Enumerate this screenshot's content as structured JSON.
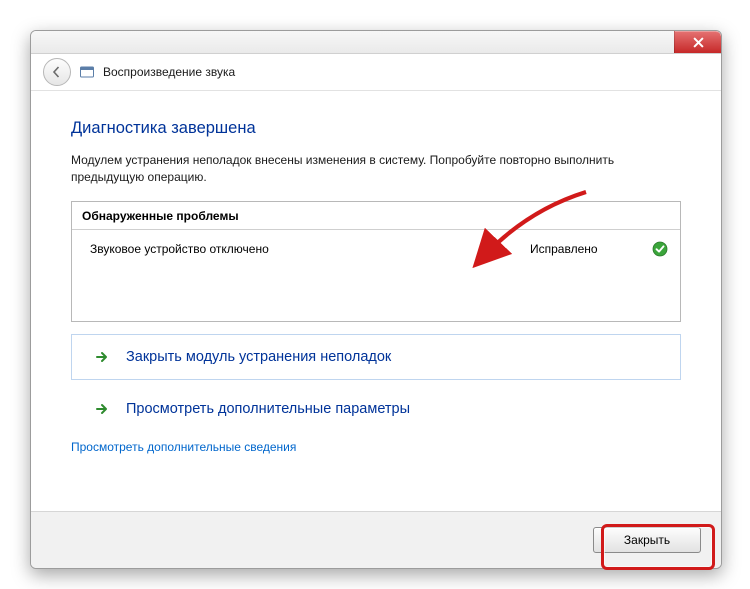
{
  "header": {
    "breadcrumb": "Воспроизведение звука"
  },
  "main": {
    "heading": "Диагностика завершена",
    "description": "Модулем устранения неполадок внесены изменения в систему. Попробуйте повторно выполнить предыдущую операцию.",
    "problems_header": "Обнаруженные проблемы",
    "problems": [
      {
        "name": "Звуковое устройство отключено",
        "status": "Исправлено",
        "state_icon": "check"
      }
    ],
    "choice_close_troubleshooter": "Закрыть модуль устранения неполадок",
    "choice_extra_params": "Просмотреть дополнительные параметры",
    "link_more_info": "Просмотреть дополнительные сведения"
  },
  "footer": {
    "close_button": "Закрыть"
  }
}
